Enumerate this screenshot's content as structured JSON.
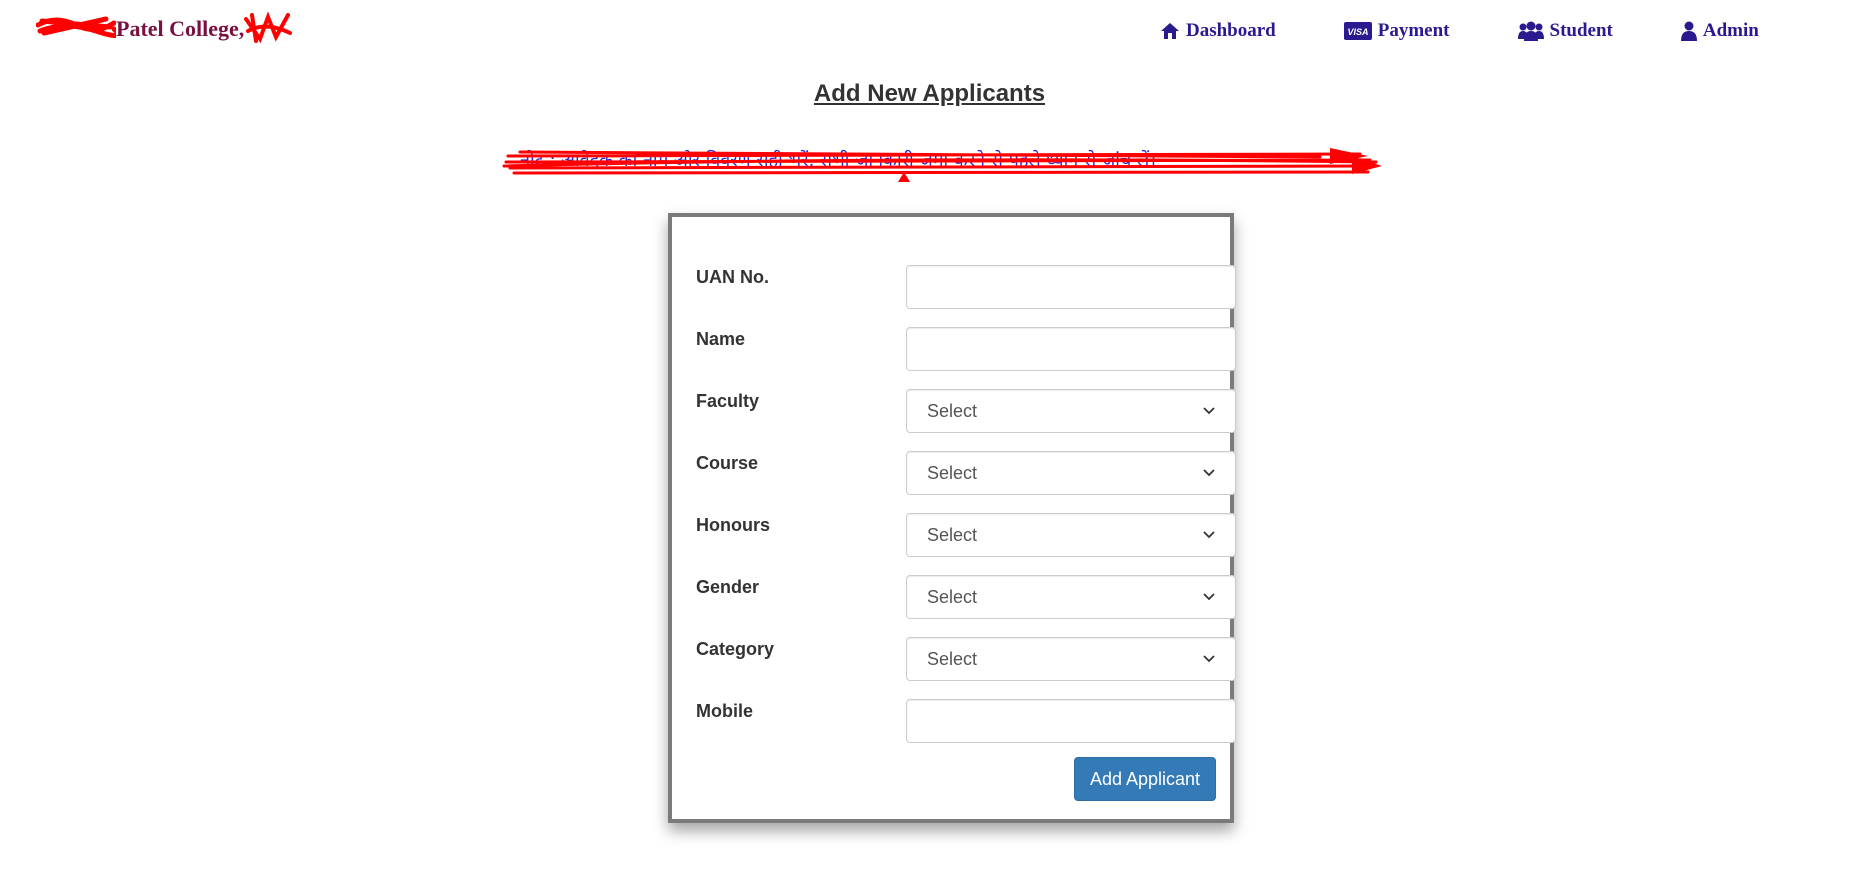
{
  "header": {
    "brand_text": "Patel College,",
    "nav": [
      {
        "label": "Dashboard",
        "icon": "home-icon"
      },
      {
        "label": "Payment",
        "icon": "visa-card-icon"
      },
      {
        "label": "Student",
        "icon": "users-icon"
      },
      {
        "label": "Admin",
        "icon": "user-icon"
      }
    ]
  },
  "page": {
    "title": "Add New Applicants",
    "notice": "नोट : आवेदक का नाम और विवरण सही भरें, सभी जानकारी जमा करने से पहले ध्यान से जांच लें।"
  },
  "form": {
    "fields": [
      {
        "label": "UAN No.",
        "type": "text",
        "value": ""
      },
      {
        "label": "Name",
        "type": "text",
        "value": ""
      },
      {
        "label": "Faculty",
        "type": "select",
        "value": "Select"
      },
      {
        "label": "Course",
        "type": "select",
        "value": "Select"
      },
      {
        "label": "Honours",
        "type": "select",
        "value": "Select"
      },
      {
        "label": "Gender",
        "type": "select",
        "value": "Select"
      },
      {
        "label": "Category",
        "type": "select",
        "value": "Select"
      },
      {
        "label": "Mobile",
        "type": "text",
        "value": ""
      }
    ],
    "submit_label": "Add Applicant"
  },
  "colors": {
    "nav_text": "#2a1a8f",
    "brand_text": "#7a1040",
    "button_bg": "#337ab7",
    "redaction": "#ff0000"
  }
}
